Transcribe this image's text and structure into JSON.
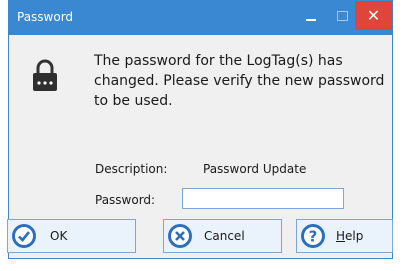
{
  "window": {
    "title": "Password",
    "close_glyph": "✕"
  },
  "message": "The password for the LogTag(s) has changed. Please verify the new password to be used.",
  "message_icon": "lock-icon",
  "description": {
    "label": "Description:",
    "value": "Password Update"
  },
  "password": {
    "label": "Password:",
    "value": ""
  },
  "buttons": {
    "ok": {
      "label": "OK",
      "icon": "check-circle-icon"
    },
    "cancel": {
      "label": "Cancel",
      "icon": "x-circle-icon"
    },
    "help": {
      "label_first": "H",
      "label_rest": "elp",
      "icon": "question-icon"
    }
  },
  "colors": {
    "titlebar": "#3a87d2",
    "close": "#e0453a",
    "accent_icon": "#2d6fbe"
  }
}
